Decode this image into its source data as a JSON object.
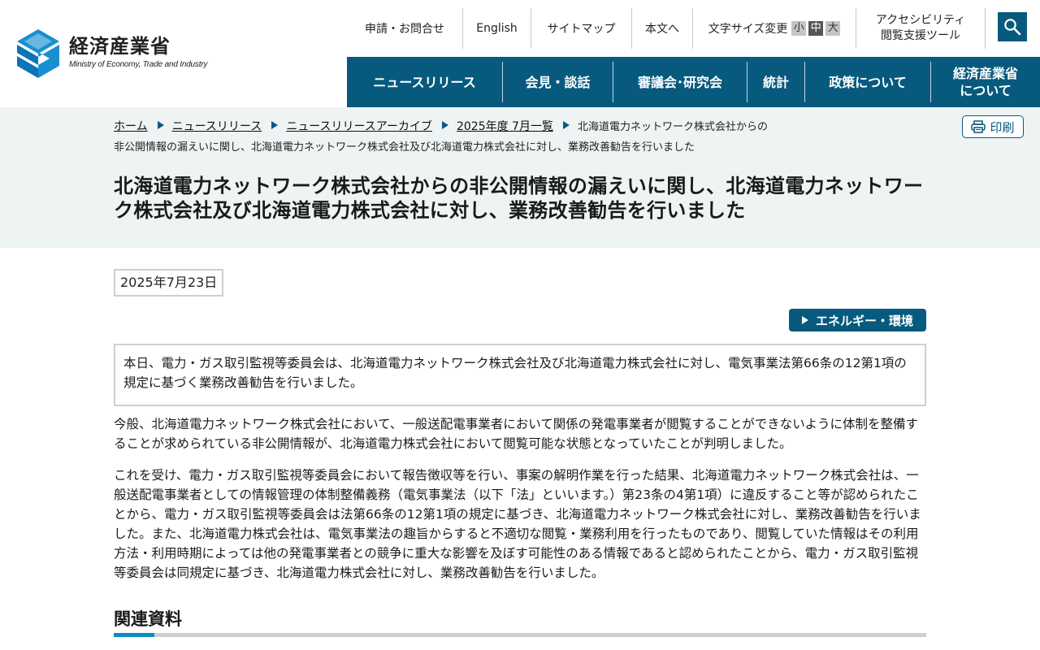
{
  "site": {
    "logo_ja": "経済産業省",
    "logo_en": "Ministry of Economy, Trade and Industry",
    "brand_color": "#075a7e"
  },
  "utility": {
    "contact": "申請・お問合せ",
    "english": "English",
    "sitemap": "サイトマップ",
    "skip": "本文へ",
    "font_size_label": "文字サイズ変更",
    "size_small": "小",
    "size_medium": "中",
    "size_large": "大",
    "accessibility_line1": "アクセシビリティ",
    "accessibility_line2": "閲覧支援ツール",
    "search_icon": "search-icon"
  },
  "gnav": {
    "news": "ニュースリリース",
    "press": "会見・談話",
    "council": "審議会･研究会",
    "stats": "統計",
    "policy": "政策について",
    "about_line1": "経済産業省",
    "about_line2": "について"
  },
  "breadcrumb": {
    "home": "ホーム",
    "news": "ニュースリリース",
    "archive": "ニュースリリースアーカイブ",
    "month": "2025年度 7月一覧",
    "current_line1": "北海道電力ネットワーク株式会社からの",
    "current_line2": "非公開情報の漏えいに関し、北海道電力ネットワーク株式会社及び北海道電力株式会社に対し、業務改善勧告を行いました"
  },
  "print_label": "印刷",
  "title": "北海道電力ネットワーク株式会社からの非公開情報の漏えいに関し、北海道電力ネットワーク株式会社及び北海道電力株式会社に対し、業務改善勧告を行いました",
  "date": "2025年7月23日",
  "category_tag": "エネルギー・環境",
  "lead": "本日、電力・ガス取引監視等委員会は、北海道電力ネットワーク株式会社及び北海道電力株式会社に対し、電気事業法第66条の12第1項の規定に基づく業務改善勧告を行いました。",
  "paragraphs": [
    "今般、北海道電力ネットワーク株式会社において、一般送配電事業者において関係の発電事業者が閲覧することができないように体制を整備することが求められている非公開情報が、北海道電力株式会社において閲覧可能な状態となっていたことが判明しました。",
    "これを受け、電力・ガス取引監視等委員会において報告徴収等を行い、事案の解明作業を行った結果、北海道電力ネットワーク株式会社は、一般送配電事業者としての情報管理の体制整備義務（電気事業法（以下「法」といいます。）第23条の4第1項）に違反すること等が認められたことから、電力・ガス取引監視等委員会は法第66条の12第1項の規定に基づき、北海道電力ネットワーク株式会社に対し、業務改善勧告を行いました。また、北海道電力株式会社は、電気事業法の趣旨からすると不適切な閲覧・業務利用を行ったものであり、閲覧していた情報はその利用方法・利用時期によっては他の発電事業者との競争に重大な影響を及ぼす可能性のある情報であると認められたことから、電力・ガス取引監視等委員会は同規定に基づき、北海道電力株式会社に対し、業務改善勧告を行いました。"
  ],
  "related_heading": "関連資料"
}
